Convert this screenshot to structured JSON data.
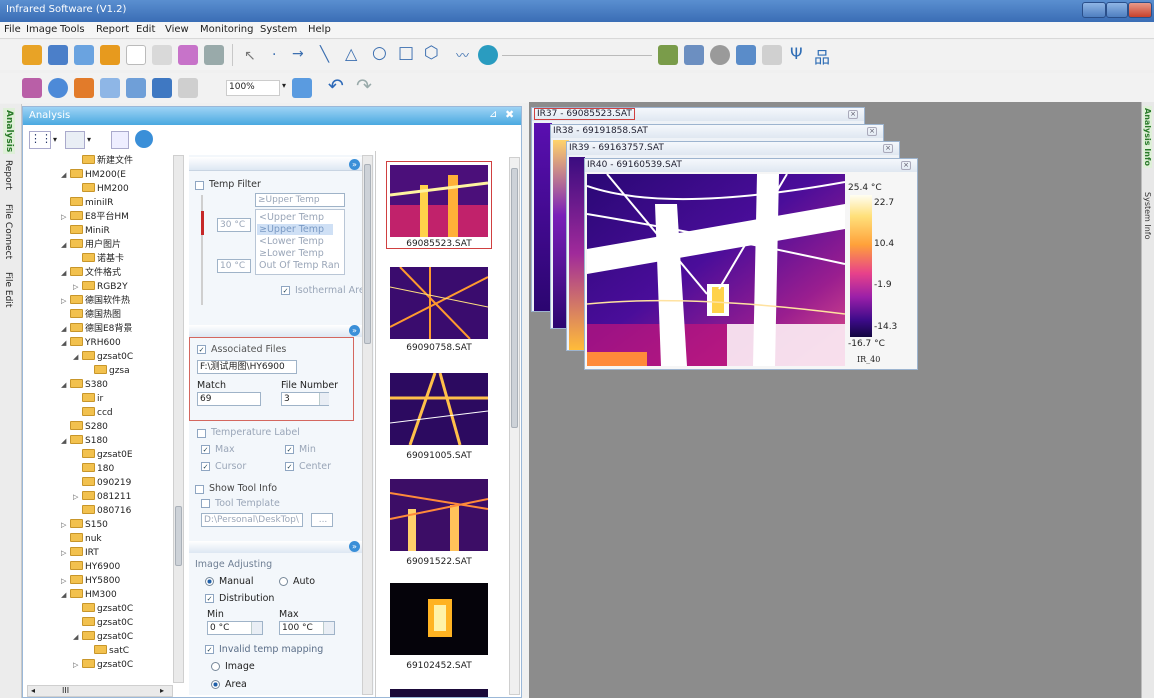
{
  "window": {
    "title": "Infrared Software (V1.2)"
  },
  "menu": [
    {
      "id": "file",
      "label": "File"
    },
    {
      "id": "image",
      "label": "Image"
    },
    {
      "id": "tools",
      "label": "Tools"
    },
    {
      "id": "report",
      "label": "Report"
    },
    {
      "id": "edit",
      "label": "Edit"
    },
    {
      "id": "view",
      "label": "View"
    },
    {
      "id": "monitoring",
      "label": "Monitoring"
    },
    {
      "id": "system",
      "label": "System"
    },
    {
      "id": "help",
      "label": "Help"
    }
  ],
  "toolbar2": {
    "zoom": "100%"
  },
  "left_tabs": [
    "Analysis",
    "Report",
    "File Connect",
    "File Edit"
  ],
  "right_tabs": [
    "Analysis Info",
    "System Info"
  ],
  "analysis": {
    "title": "Analysis",
    "tree": [
      {
        "label": "新建文件",
        "indent": 3,
        "expander": "none"
      },
      {
        "label": "HM200(E",
        "indent": 2,
        "expander": "open"
      },
      {
        "label": "HM200",
        "indent": 3,
        "expander": "none"
      },
      {
        "label": "miniIR",
        "indent": 2,
        "expander": "none"
      },
      {
        "label": "E8平台HM",
        "indent": 2,
        "expander": "closed"
      },
      {
        "label": "MiniR",
        "indent": 2,
        "expander": "none"
      },
      {
        "label": "用户图片",
        "indent": 2,
        "expander": "open"
      },
      {
        "label": "诺基卡",
        "indent": 3,
        "expander": "none"
      },
      {
        "label": "文件格式",
        "indent": 2,
        "expander": "open"
      },
      {
        "label": "RGB2Y",
        "indent": 3,
        "expander": "closed"
      },
      {
        "label": "德国软件热",
        "indent": 2,
        "expander": "closed"
      },
      {
        "label": "德国热图",
        "indent": 2,
        "expander": "none"
      },
      {
        "label": "德国E8背景",
        "indent": 2,
        "expander": "open"
      },
      {
        "label": "YRH600",
        "indent": 2,
        "expander": "open"
      },
      {
        "label": "gzsat0C",
        "indent": 3,
        "expander": "open"
      },
      {
        "label": "gzsa",
        "indent": 4,
        "expander": "none"
      },
      {
        "label": "S380",
        "indent": 2,
        "expander": "open"
      },
      {
        "label": "ir",
        "indent": 3,
        "expander": "none"
      },
      {
        "label": "ccd",
        "indent": 3,
        "expander": "none"
      },
      {
        "label": "S280",
        "indent": 2,
        "expander": "none"
      },
      {
        "label": "S180",
        "indent": 2,
        "expander": "open"
      },
      {
        "label": "gzsat0E",
        "indent": 3,
        "expander": "none"
      },
      {
        "label": "180",
        "indent": 3,
        "expander": "none"
      },
      {
        "label": "090219",
        "indent": 3,
        "expander": "none"
      },
      {
        "label": "081211",
        "indent": 3,
        "expander": "closed"
      },
      {
        "label": "080716",
        "indent": 3,
        "expander": "none"
      },
      {
        "label": "S150",
        "indent": 2,
        "expander": "closed"
      },
      {
        "label": "nuk",
        "indent": 2,
        "expander": "none"
      },
      {
        "label": "IRT",
        "indent": 2,
        "expander": "closed"
      },
      {
        "label": "HY6900",
        "indent": 2,
        "expander": "none"
      },
      {
        "label": "HY5800",
        "indent": 2,
        "expander": "closed"
      },
      {
        "label": "HM300",
        "indent": 2,
        "expander": "open"
      },
      {
        "label": "gzsat0C",
        "indent": 3,
        "expander": "none"
      },
      {
        "label": "gzsat0C",
        "indent": 3,
        "expander": "none"
      },
      {
        "label": "gzsat0C",
        "indent": 3,
        "expander": "open"
      },
      {
        "label": "satC",
        "indent": 4,
        "expander": "none"
      },
      {
        "label": "gzsat0C",
        "indent": 3,
        "expander": "closed"
      }
    ],
    "temp_filter": {
      "label": "Temp Filter",
      "header": "≥Upper Temp",
      "options": [
        "<Upper Temp",
        "≥Upper Temp",
        "<Lower Temp",
        "≥Lower Temp",
        "Out Of Temp Ran"
      ],
      "upper": "30 °C",
      "lower": "10 °C",
      "isothermal": "Isothermal Area"
    },
    "associated": {
      "label": "Associated Files",
      "path": "F:\\测试用图\\HY6900",
      "match_label": "Match",
      "match_value": "69",
      "file_number_label": "File Number",
      "file_number_value": "3"
    },
    "temperature_label": {
      "label": "Temperature Label",
      "max": "Max",
      "min": "Min",
      "cursor": "Cursor",
      "center": "Center"
    },
    "show_tool_info": "Show Tool Info",
    "tool_template": {
      "label": "Tool Template",
      "path": "D:\\Personal\\DeskTop\\",
      "button": "..."
    },
    "image_adjusting": {
      "title": "Image Adjusting",
      "manual": "Manual",
      "auto": "Auto",
      "distribution": "Distribution",
      "min_label": "Min",
      "max_label": "Max",
      "min_value": "0 °C",
      "max_value": "100 °C",
      "invalid": "Invalid temp mapping",
      "image": "Image",
      "area": "Area"
    },
    "thumbnails": [
      "69085523.SAT",
      "69090758.SAT",
      "69091005.SAT",
      "69091522.SAT",
      "69102452.SAT"
    ]
  },
  "ir_windows": [
    {
      "title": "IR37 - 69085523.SAT"
    },
    {
      "title": "IR38 - 69191858.SAT"
    },
    {
      "title": "IR39 - 69163757.SAT"
    },
    {
      "title": "IR40 - 69160539.SAT"
    }
  ],
  "colorbar": {
    "max": "25.4 °C",
    "min": "-16.7 °C",
    "ticks": [
      "22.7",
      "10.4",
      "-1.9",
      "-14.3"
    ],
    "tick_levels": [
      0.936,
      0.651,
      0.359,
      0.064
    ],
    "caption": "IR_40"
  }
}
